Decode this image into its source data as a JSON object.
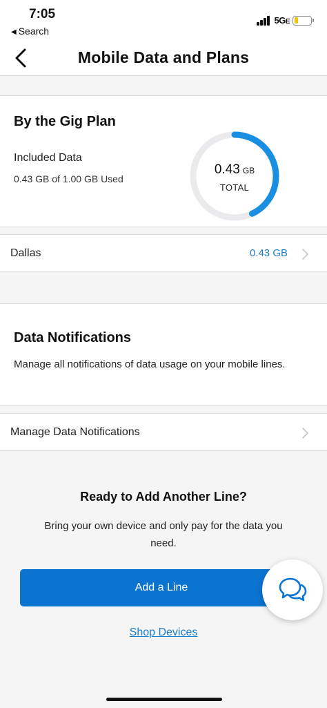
{
  "status_bar": {
    "time": "7:05",
    "back_app": "Search",
    "network": "5G",
    "network_suffix": "E"
  },
  "header": {
    "title": "Mobile Data and Plans"
  },
  "plan": {
    "name": "By the Gig Plan",
    "included_label": "Included Data",
    "usage_text": "0.43 GB of 1.00 GB Used",
    "used_gb": 0.43,
    "total_gb": 1.0,
    "gauge_value": "0.43",
    "gauge_unit": "GB",
    "gauge_caption": "TOTAL"
  },
  "lines": [
    {
      "label": "Dallas",
      "value": "0.43 GB"
    }
  ],
  "notifications": {
    "title": "Data Notifications",
    "description": "Manage all notifications of data usage on your mobile lines.",
    "manage_label": "Manage Data Notifications"
  },
  "promo": {
    "title": "Ready to Add Another Line?",
    "description": "Bring your own device and only pay for the data you need.",
    "button_label": "Add a Line",
    "link_label": "Shop Devices"
  },
  "colors": {
    "accent": "#0b74d1",
    "link": "#1d7fc9",
    "gauge_track": "#ebebed",
    "gauge_fill": "#1a8ee0",
    "battery": "#f2c300"
  },
  "icons": {
    "back": "chevron-left-icon",
    "row_arrow": "chevron-right-icon",
    "chat": "chat-bubbles-icon"
  }
}
